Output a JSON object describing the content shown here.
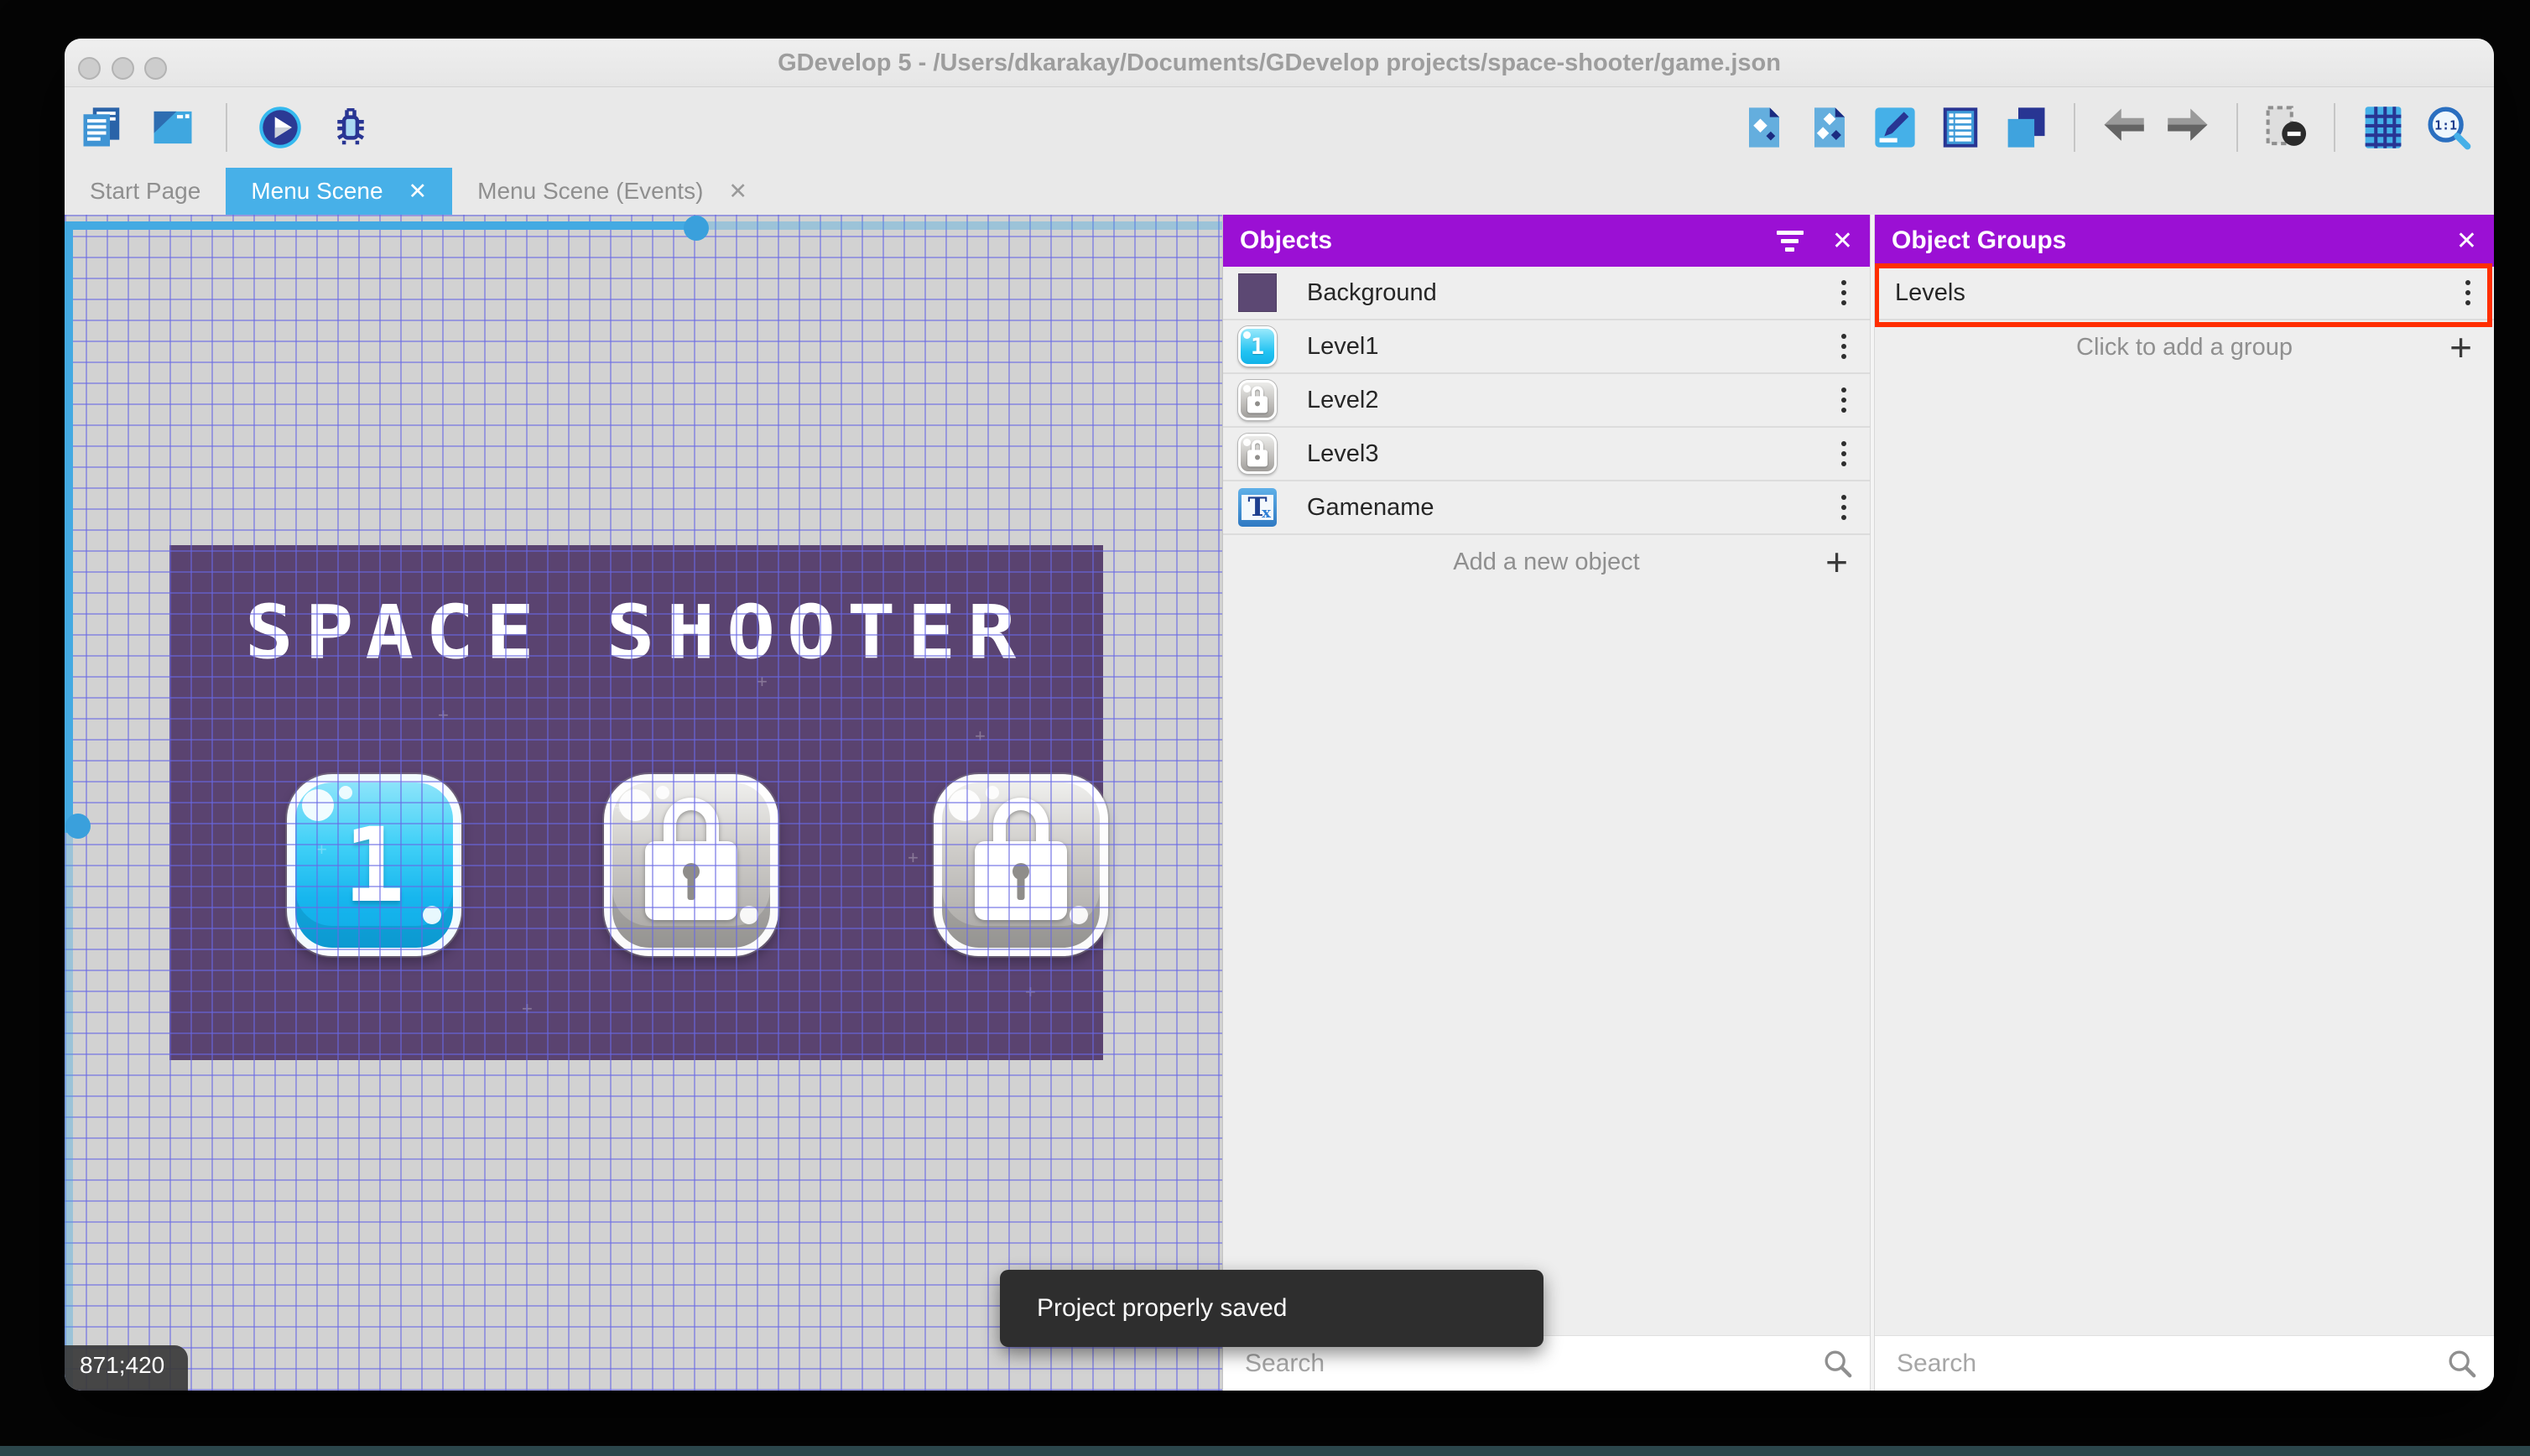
{
  "window": {
    "title": "GDevelop 5 - /Users/dkarakay/Documents/GDevelop projects/space-shooter/game.json",
    "traffic_lights": [
      "close",
      "minimize",
      "zoom"
    ]
  },
  "toolbar": {
    "left_icons": [
      "project-manager-icon",
      "open-scene-window-icon",
      "preview-play-icon",
      "debug-icon"
    ],
    "right_icons": [
      "add-object-icon",
      "add-objects-icon",
      "edit-scene-properties-icon",
      "objects-list-icon",
      "layers-icon",
      "undo-icon",
      "redo-icon",
      "render-mask-icon",
      "grid-icon",
      "zoom-1-1-icon"
    ]
  },
  "tabs": [
    {
      "label": "Start Page",
      "active": false,
      "closable": false
    },
    {
      "label": "Menu Scene",
      "active": true,
      "closable": true
    },
    {
      "label": "Menu Scene (Events)",
      "active": false,
      "closable": true
    }
  ],
  "canvas": {
    "scene_title": "SPACE SHOOTER",
    "level_buttons": [
      {
        "label": "1",
        "locked": false
      },
      {
        "label": "",
        "locked": true
      },
      {
        "label": "",
        "locked": true
      }
    ],
    "coordinates": "871;420"
  },
  "objects_panel": {
    "title": "Objects",
    "rows": [
      {
        "label": "Background",
        "icon": "background-swatch"
      },
      {
        "label": "Level1",
        "icon": "level-1-button-thumb"
      },
      {
        "label": "Level2",
        "icon": "locked-button-thumb"
      },
      {
        "label": "Level3",
        "icon": "locked-button-thumb"
      },
      {
        "label": "Gamename",
        "icon": "text-object-thumb"
      }
    ],
    "add_label": "Add a new object",
    "search_placeholder": "Search"
  },
  "groups_panel": {
    "title": "Object Groups",
    "rows": [
      {
        "label": "Levels",
        "highlighted": true
      }
    ],
    "add_label": "Click to add a group",
    "search_placeholder": "Search"
  },
  "toast": {
    "message": "Project properly saved"
  },
  "glyphs": {
    "close": "✕",
    "plus": "+"
  },
  "colors": {
    "accent_blue": "#47b0e8",
    "panel_header_purple": "#9b10d4",
    "highlight_red": "#ff2e00",
    "scene_purple": "#5a4370",
    "canvas_gray": "#d2d2d2",
    "grid_blue": "#6868e4",
    "toast_dark": "#2e2e2e"
  }
}
